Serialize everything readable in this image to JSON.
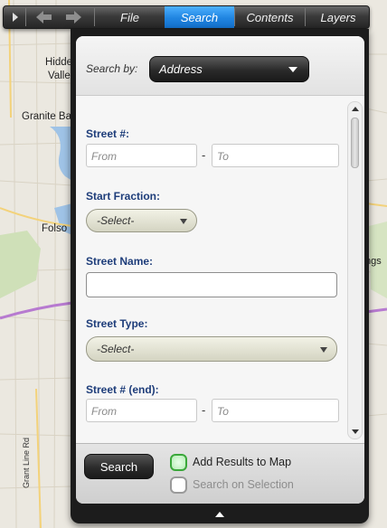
{
  "toolbar": {
    "tabs": [
      {
        "label": "File",
        "active": false
      },
      {
        "label": "Search",
        "active": true
      },
      {
        "label": "Contents",
        "active": false
      },
      {
        "label": "Layers",
        "active": false
      }
    ]
  },
  "map": {
    "labels": {
      "hidden_valley_1": "Hidde",
      "hidden_valley_2": "Valle",
      "granite_bay": "Granite Bay",
      "folsom": "Folso",
      "grant_line_rd": "Grant Line Rd",
      "shingle_springs": "ngs"
    }
  },
  "search_by": {
    "label": "Search by:",
    "value": "Address"
  },
  "form": {
    "street_num": {
      "label": "Street #:",
      "from_placeholder": "From",
      "to_placeholder": "To",
      "dash": "-"
    },
    "start_fraction": {
      "label": "Start Fraction:",
      "value": "-Select-"
    },
    "street_name": {
      "label": "Street Name:",
      "value": ""
    },
    "street_type": {
      "label": "Street Type:",
      "value": "-Select-"
    },
    "street_num_end": {
      "label": "Street # (end):",
      "from_placeholder": "From",
      "to_placeholder": "To",
      "dash": "-"
    }
  },
  "footer": {
    "search_button": "Search",
    "add_results": {
      "label": "Add Results to Map",
      "checked": true
    },
    "search_on_selection": {
      "label": "Search on Selection",
      "checked": false,
      "enabled": false
    }
  },
  "colors": {
    "active_tab": "#1f84e0",
    "field_label": "#1e3d7a",
    "checkbox_green": "#3aa83a"
  }
}
